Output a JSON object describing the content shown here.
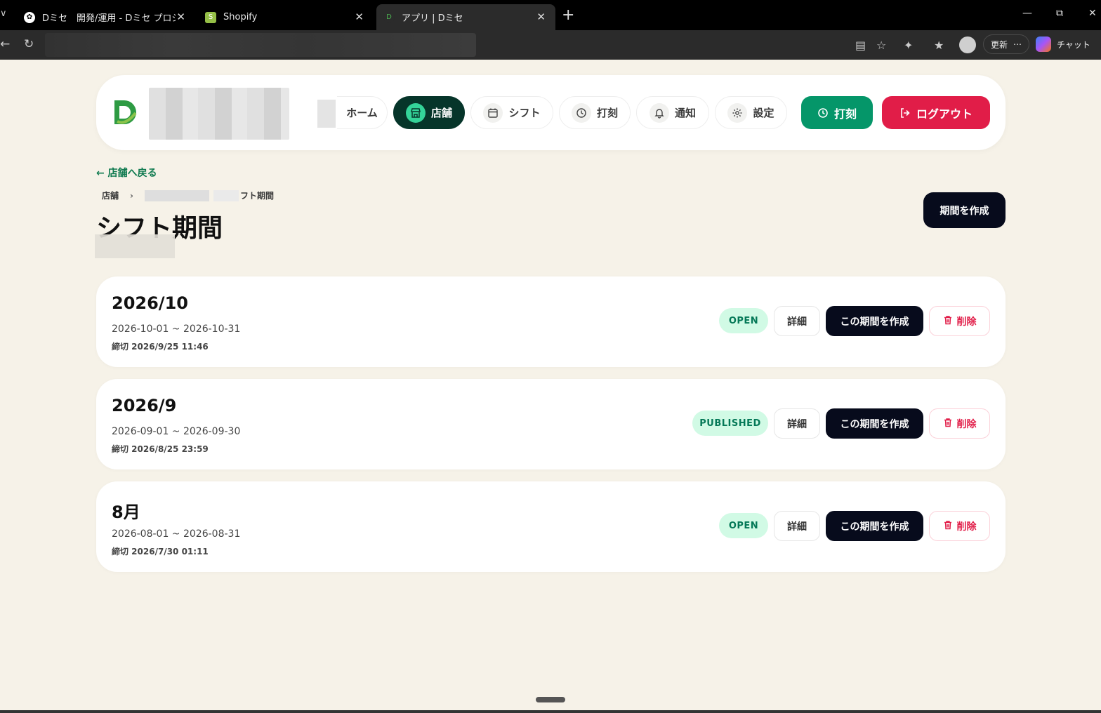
{
  "browser": {
    "tabs": [
      {
        "label": "Dミセ　開発/運用 - Dミセ プロジェクト"
      },
      {
        "label": "Shopify"
      },
      {
        "label": "アプリ | Dミセ"
      }
    ],
    "update_label": "更新",
    "chat_label": "チャット"
  },
  "nav": {
    "home": "ホーム",
    "store": "店舗",
    "shift": "シフト",
    "punch": "打刻",
    "notify": "通知",
    "settings": "設定",
    "punch_button": "打刻",
    "logout_button": "ログアウト"
  },
  "page": {
    "back_link": "← 店舗へ戻る",
    "breadcrumb_root": "店舗",
    "breadcrumb_current": "フト期間",
    "title": "シフト期間",
    "create_button": "期間を作成"
  },
  "card_actions": {
    "detail": "詳細",
    "make": "この期間を作成",
    "delete": "削除"
  },
  "periods": [
    {
      "title": "2026/10",
      "range": "2026-10-01 ~ 2026-10-31",
      "deadline": "締切 2026/9/25 11:46",
      "status": "OPEN"
    },
    {
      "title": "2026/9",
      "range": "2026-09-01 ~ 2026-09-30",
      "deadline": "締切 2026/8/25 23:59",
      "status": "PUBLISHED"
    },
    {
      "title": "8月",
      "range": "2026-08-01 ~ 2026-08-31",
      "deadline": "締切 2026/7/30 01:11",
      "status": "OPEN"
    }
  ],
  "colors": {
    "accent_dark": "#06352a",
    "punch_green": "#059669",
    "logout_red": "#e11d48",
    "badge_bg": "#d1fae5",
    "background": "#f6f2e8"
  }
}
